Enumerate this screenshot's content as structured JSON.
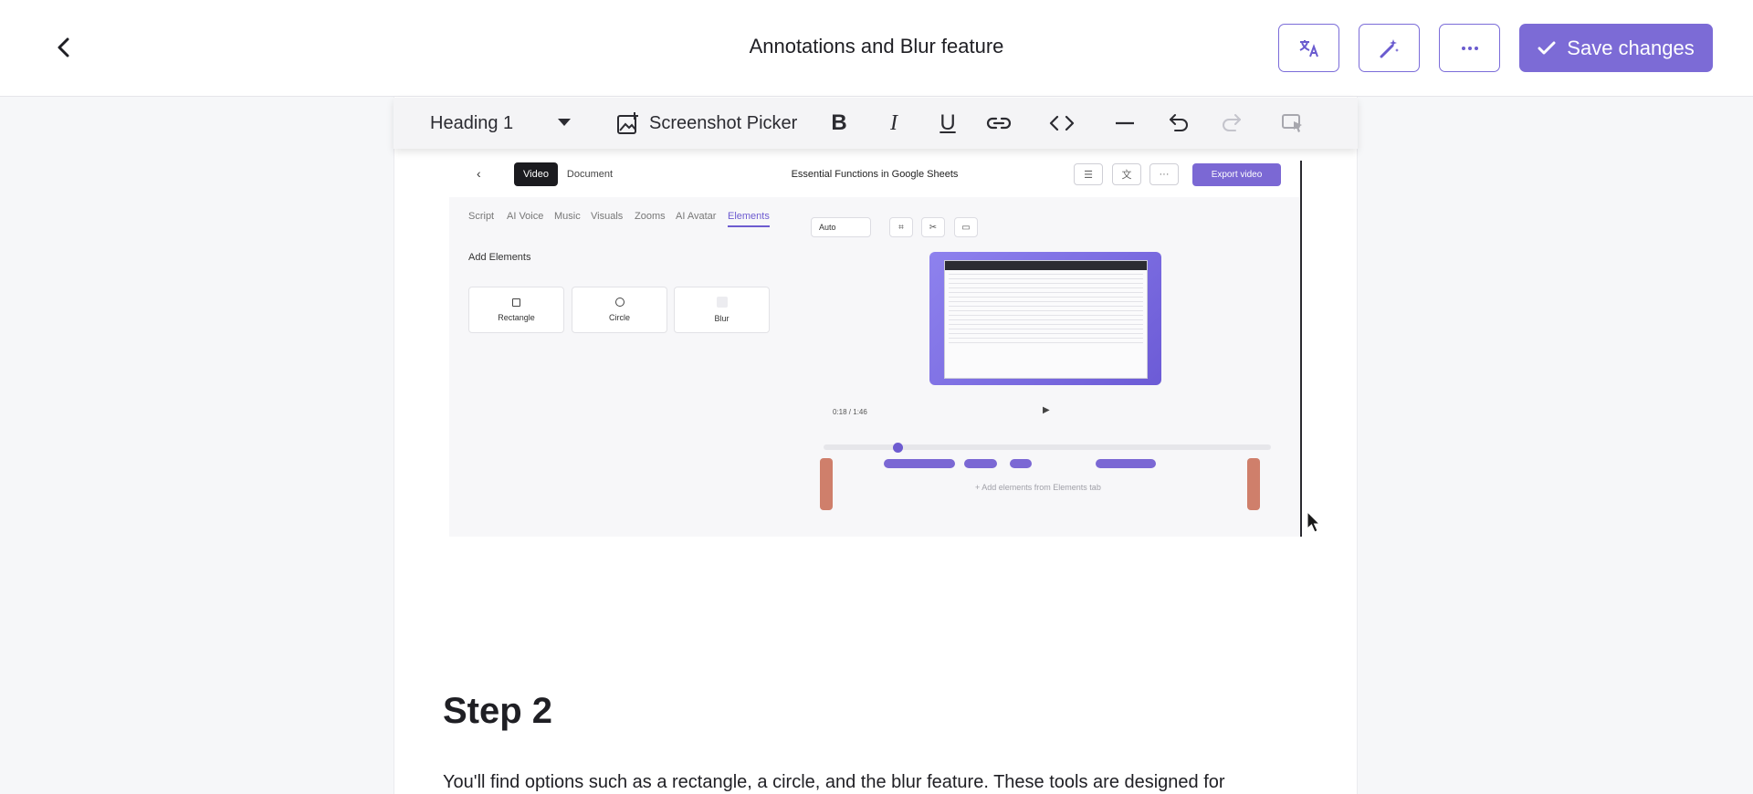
{
  "header": {
    "title": "Annotations and Blur feature",
    "save_label": "Save changes",
    "icons": [
      "chevron-left-icon",
      "translate-icon",
      "magic-wand-icon",
      "more-icon",
      "check-icon"
    ]
  },
  "toolbar": {
    "heading_select": "Heading 1",
    "screenshot_picker_label": "Screenshot Picker",
    "buttons": [
      "bold",
      "italic",
      "underline",
      "link",
      "code",
      "horizontal-rule",
      "undo",
      "redo",
      "select-element"
    ]
  },
  "screenshot": {
    "tabs": {
      "video": "Video",
      "document": "Document"
    },
    "title": "Essential Functions in Google Sheets",
    "export_label": "Export video",
    "nav_tabs": [
      "Script",
      "AI Voice",
      "Music",
      "Visuals",
      "Zooms",
      "AI Avatar",
      "Elements"
    ],
    "active_nav": "Elements",
    "section_label": "Add Elements",
    "elements": [
      "Rectangle",
      "Circle",
      "Blur"
    ],
    "auto_select": "Auto",
    "time": "0:18 / 1:46",
    "add_hint": "+ Add elements from Elements tab"
  },
  "content": {
    "step_title": "Step 2",
    "paragraph": "You'll find options such as a rectangle, a circle, and the blur feature. These tools are designed for"
  },
  "colors": {
    "accent": "#7c6bd6",
    "clip": "#7b68d4",
    "trim_handle": "#cf7f6b"
  }
}
